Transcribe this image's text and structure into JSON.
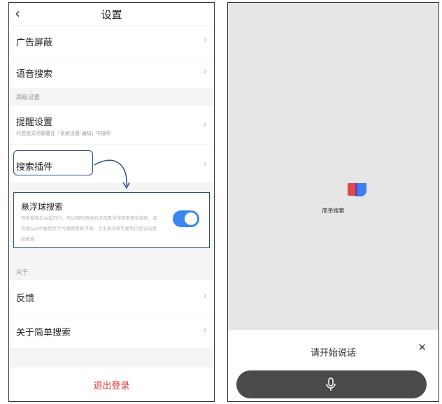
{
  "settings": {
    "title": "设置",
    "back_icon": "chevron-left-icon",
    "items": {
      "ad_block": "广告屏蔽",
      "voice_search": "语音搜索",
      "reminder": "提醒设置",
      "reminder_sub": "开启或关闭需要在「系统设置-通知」中操作",
      "search_plugin": "搜索插件",
      "feedback": "反馈",
      "about": "关于简单搜索"
    },
    "sections": {
      "advanced": "高级设置",
      "about": "关于"
    },
    "popup": {
      "title": "悬浮球搜索",
      "description": "简单搜索后台运行时，可以随时随地的点击悬浮球使用语音搜索，在其他app中复制文字可做搜索悬浮球，点击悬浮球可复制内容自动发起搜索",
      "toggle_on": true,
      "toggle_color": "#3a86f0"
    },
    "logout": "退出登录",
    "logout_color": "#e53935",
    "accent_color": "#2b4d86"
  },
  "voice": {
    "app_name": "简单搜索",
    "prompt": "请开始说话",
    "close_icon": "close-icon",
    "mic_icon": "microphone-icon"
  }
}
